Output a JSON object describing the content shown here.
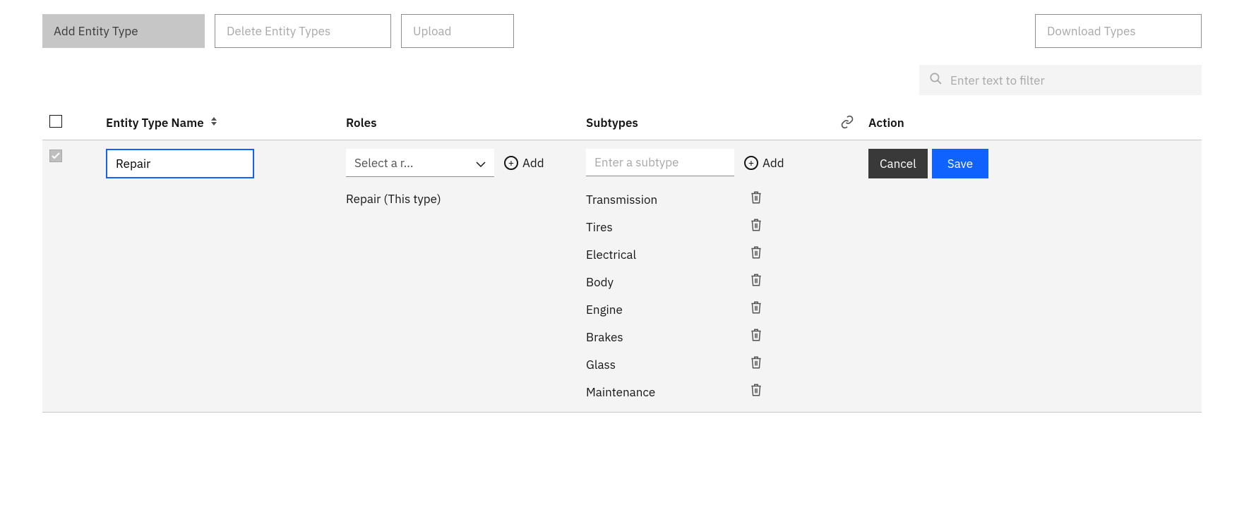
{
  "toolbar": {
    "add_entity_label": "Add Entity Type",
    "delete_entity_label": "Delete Entity Types",
    "upload_label": "Upload",
    "download_label": "Download Types"
  },
  "filter": {
    "placeholder": "Enter text to filter"
  },
  "columns": {
    "col1": "Entity Type Name",
    "col2": "Roles",
    "col3": "Subtypes",
    "col4": "Action"
  },
  "row": {
    "name_value": "Repair",
    "role_placeholder": "Select a r...",
    "role_add_label": "Add",
    "roles_list": [
      "Repair (This type)"
    ],
    "subtype_placeholder": "Enter a subtype",
    "subtype_add_label": "Add",
    "subtypes": [
      "Transmission",
      "Tires",
      "Electrical",
      "Body",
      "Engine",
      "Brakes",
      "Glass",
      "Maintenance"
    ]
  },
  "actions": {
    "cancel": "Cancel",
    "save": "Save"
  }
}
